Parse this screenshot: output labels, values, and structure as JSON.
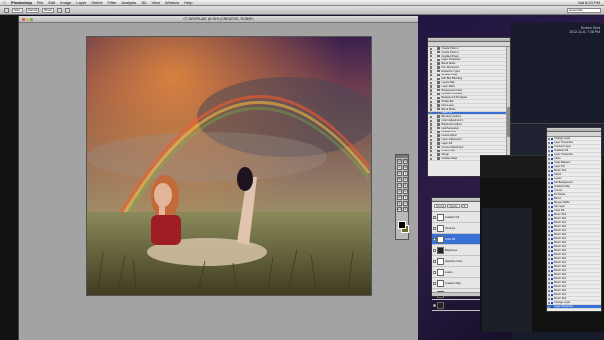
{
  "menubar": {
    "apple": "",
    "items": [
      "Photoshop",
      "File",
      "Edit",
      "Image",
      "Layer",
      "Select",
      "Filter",
      "Analysis",
      "3D",
      "View",
      "Window",
      "Help"
    ],
    "right": [
      "Sat 6:23 PM"
    ]
  },
  "optbar": {
    "controls": [
      "Size:",
      "Normal",
      "Brush"
    ],
    "workspace": "Essentials"
  },
  "document": {
    "title": "CT-KROPLUIE @ 25% (CREATIVE, RGB/8*)"
  },
  "tools": {
    "glyphs": [
      "M",
      "M",
      "L",
      "W",
      "C",
      "I",
      "B",
      "S",
      "H",
      "E",
      "G",
      "O",
      "P",
      "T",
      "A",
      "U",
      "H",
      "Z"
    ]
  },
  "history": {
    "items": [
      "Create Posts 1",
      "Create Posts 2",
      "Gradient Posts",
      "Layer Properties",
      "Blend Mode",
      "Pen Movement",
      "Rasterize Types",
      "Gradient Map",
      "Edit Blur Blending",
      "Levels Map",
      "Layer Mask",
      "Background Color",
      "Gradient Fill Base",
      "Background Fill Adjust",
      "Stroke Bar",
      "New Layer",
      "Blend Mode",
      "Layer Fill",
      "Blending Options",
      "Color Adjustment 1",
      "Brightness Adjust",
      "Hue/Saturation",
      "Gradient Fill",
      "Levels Adjust",
      "Layer Adjustment",
      "Layer Fill",
      "Curves Adjustment",
      "Smart Filter",
      "Merge",
      "Gradient Map"
    ],
    "selected_index": 17
  },
  "layers": {
    "header": [
      "Normal",
      "Opacity",
      "Fill"
    ],
    "rows": [
      {
        "name": "Gradient Fill",
        "dark": false
      },
      {
        "name": "Vibrance",
        "dark": false
      },
      {
        "name": "Color Fill",
        "dark": false
      },
      {
        "name": "Brightness",
        "dark": true
      },
      {
        "name": "Selective Color",
        "dark": false
      },
      {
        "name": "Levels",
        "dark": false
      },
      {
        "name": "Gradient Map",
        "dark": false
      },
      {
        "name": "Layer 1",
        "dark": true
      },
      {
        "name": "Background",
        "dark": true
      }
    ],
    "selected_index": 2
  },
  "actions": {
    "items": [
      "Change Layer",
      "Layer Properties",
      "Contract Layer",
      "Gradient Fill",
      "Layer Properties",
      "Close",
      "Color Balance",
      "Layer Fill",
      "Brush Tool",
      "Select",
      "Levels",
      "Set Background",
      "Gradient Map",
      "Curves",
      "Fill Stroke",
      "Blend",
      "Merge Visible",
      "Set Layer",
      "Color Fill",
      "Brush Tool",
      "Brush Tool",
      "Brush Tool",
      "Brush Tool",
      "Brush Tool",
      "Brush Tool",
      "Brush Tool",
      "Brush Tool",
      "Brush Tool",
      "Brush Tool",
      "Brush Tool",
      "Brush Tool",
      "Brush Tool",
      "Brush Tool",
      "Brush Tool",
      "Brush Tool",
      "Brush Tool",
      "Brush Tool",
      "Brush Tool",
      "Brush Tool",
      "Brush Tool",
      "Brush Tool",
      "Change Layer",
      "Layer Properties"
    ],
    "selected_index": 42
  },
  "desktop": {
    "clock_line1": "Screen Shot",
    "clock_line2": "2012-11-6, 7:28 PM"
  },
  "colors": {
    "selection_blue": "#3a6fd4",
    "panel_bg": "#e9e9e9",
    "doc_bg": "#a3a3a3"
  }
}
